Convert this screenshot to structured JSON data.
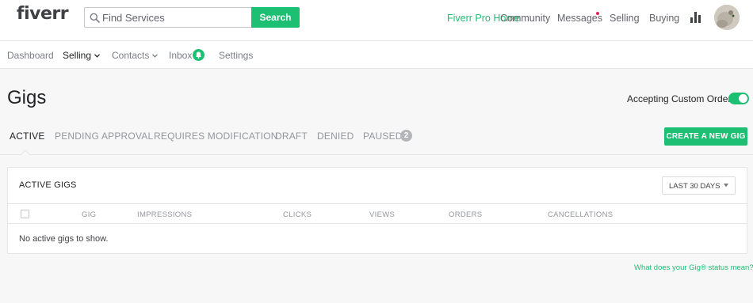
{
  "header": {
    "logo": "fiverr",
    "search": {
      "placeholder": "Find Services",
      "button_label": "Search"
    },
    "nav": {
      "pro": "Fiverr Pro Home",
      "community": "Community",
      "messages": "Messages",
      "selling": "Selling",
      "buying": "Buying"
    }
  },
  "subnav": {
    "dashboard": "Dashboard",
    "selling": "Selling",
    "contacts": "Contacts",
    "inbox": "Inbox",
    "settings": "Settings"
  },
  "page": {
    "title": "Gigs",
    "custom_orders_label": "Accepting Custom Orders",
    "custom_orders_enabled": true,
    "create_button": "CREATE A NEW GIG"
  },
  "tabs": [
    {
      "label": "ACTIVE",
      "active": true
    },
    {
      "label": "PENDING APPROVAL"
    },
    {
      "label": "REQUIRES MODIFICATION"
    },
    {
      "label": "DRAFT"
    },
    {
      "label": "DENIED"
    },
    {
      "label": "PAUSED",
      "count": "2"
    }
  ],
  "panel": {
    "title": "ACTIVE GIGS",
    "range": "LAST 30 DAYS",
    "columns": [
      "GIG",
      "IMPRESSIONS",
      "CLICKS",
      "VIEWS",
      "ORDERS",
      "CANCELLATIONS"
    ],
    "empty_message": "No active gigs to show."
  },
  "help_link": "What does your Gig® status mean?",
  "colors": {
    "brand_green": "#1dbf73",
    "notification_red": "#e0245e"
  }
}
